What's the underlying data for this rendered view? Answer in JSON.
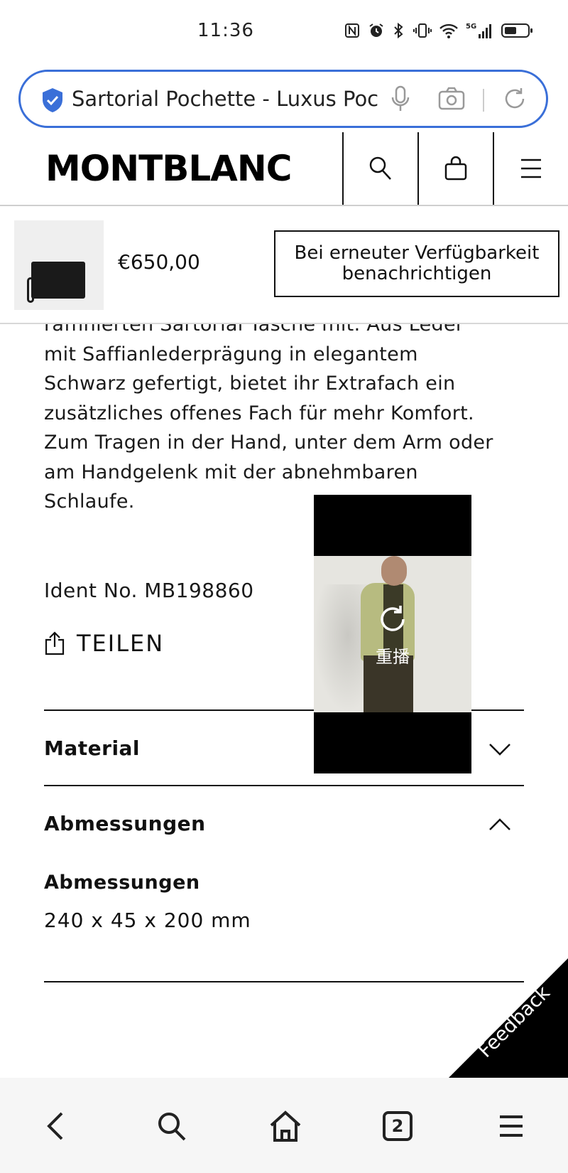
{
  "status_bar": {
    "time": "11:36",
    "icons": [
      "nfc-icon",
      "alarm-icon",
      "bluetooth-icon",
      "vibrate-icon",
      "wifi-icon",
      "signal-5g-icon",
      "battery-icon"
    ],
    "network_label": "5G"
  },
  "browser": {
    "url_title": "Sartorial Pochette - Luxus Poc",
    "tab_count": "2"
  },
  "header": {
    "logo": "MONTBLANC"
  },
  "sticky_bar": {
    "price": "€650,00",
    "notify_label": "Bei erneuter Verfügbarkeit benachrichtigen"
  },
  "description": {
    "lines": [
      "raffinierten Sartorial Tasche mit. Aus Leder",
      "mit Saffianlederprägung in elegantem",
      "Schwarz gefertigt, bietet ihr Extrafach ein",
      "zusätzliches offenes Fach für mehr Komfort.",
      "Zum Tragen in der Hand, unter dem Arm oder",
      "am Handgelenk mit der abnehmbaren",
      "Schlaufe."
    ]
  },
  "product": {
    "ident": "Ident No. MB198860",
    "share_label": "TEILEN"
  },
  "accordion": {
    "material_title": "Material",
    "dimensions_title": "Abmessungen",
    "dimensions_label": "Abmessungen",
    "dimensions_value": "240 x 45 x 200 mm"
  },
  "video": {
    "replay_label": "重播"
  },
  "feedback": {
    "label": "Feedback"
  },
  "colors": {
    "accent": "#3a6fd8",
    "text": "#111111",
    "background": "#ffffff"
  }
}
